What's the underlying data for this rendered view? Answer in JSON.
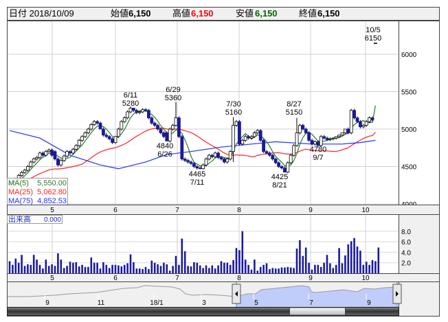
{
  "header": {
    "date_label": "日付 2018/10/09",
    "open_label": "始値",
    "open_value": "6,150",
    "high_label": "高値",
    "high_value": "6,150",
    "low_label": "安値",
    "low_value": "6,150",
    "close_label": "終値",
    "close_value": "6,150"
  },
  "legend": {
    "ma5_label": "MA(5)",
    "ma5_value": "5,550.00",
    "ma25_label": "MA(25)",
    "ma25_value": "5,062.80",
    "ma75_label": "MA(75)",
    "ma75_value": "4,852.53",
    "volume_label": "出来高",
    "volume_value": "0.000"
  },
  "colors": {
    "up_fill": "#ffffff",
    "down_fill": "#1a1a9a",
    "ma5": "#2a7a2a",
    "ma25": "#ff2020",
    "ma75": "#2030ff",
    "volume": "#1a1aa0",
    "nav_selected": "#c0cdfa"
  },
  "annotations": [
    {
      "top": "6/11",
      "bottom": "5280"
    },
    {
      "top": "6/29",
      "bottom": "5360"
    },
    {
      "top": "4840",
      "bottom": "6/26"
    },
    {
      "top": "4465",
      "bottom": "7/11"
    },
    {
      "top": "7/30",
      "bottom": "5160"
    },
    {
      "top": "8/27",
      "bottom": "5150"
    },
    {
      "top": "4425",
      "bottom": "8/21"
    },
    {
      "top": "4780",
      "bottom": "9/7"
    },
    {
      "top": "10/5",
      "bottom": "6150"
    }
  ],
  "nav": {
    "labels": [
      "9",
      "11",
      "18/1",
      "3",
      "5",
      "7",
      "9"
    ]
  },
  "chart_data": {
    "type": "candlestick",
    "price_axis": {
      "ticks": [
        "6000",
        "5500",
        "5000",
        "4500",
        "4000"
      ],
      "range": [
        4000,
        6150
      ]
    },
    "volume_axis": {
      "ticks": [
        "8.0",
        "6.0",
        "4.0",
        "2.0"
      ],
      "range": [
        0,
        9
      ]
    },
    "month_labels": [
      "5",
      "6",
      "7",
      "8",
      "9",
      "10"
    ],
    "open": [
      4260,
      4280,
      4300,
      4330,
      4380,
      4420,
      4450,
      4500,
      4560,
      4600,
      4620,
      4680,
      4650,
      4700,
      4720,
      4700,
      4600,
      4520,
      4580,
      4640,
      4700,
      4680,
      4730,
      4780,
      4850,
      4900,
      4950,
      5000,
      5060,
      5100,
      5080,
      5000,
      4920,
      4900,
      4870,
      4820,
      4900,
      5000,
      5100,
      5150,
      5230,
      5280,
      5250,
      5220,
      5230,
      5260,
      5250,
      5150,
      5080,
      5050,
      5000,
      4950,
      4950,
      4840,
      5000,
      5050,
      5150,
      4900,
      4600,
      4580,
      4560,
      4540,
      4500,
      4480,
      4470,
      4520,
      4600,
      4650,
      4630,
      4680,
      4620,
      4600,
      4560,
      4600,
      4700,
      5050,
      5100,
      4800,
      4850,
      4900,
      4880,
      4900,
      4950,
      4980,
      4850,
      4700,
      4680,
      4650,
      4600,
      4550,
      4500,
      4480,
      4425,
      4550,
      4650,
      4780,
      4950,
      5050,
      5000,
      4950,
      4850,
      4800,
      4830,
      4780,
      4900,
      4880,
      4860,
      4870,
      4880,
      4900,
      4920,
      4950,
      5000,
      4950,
      5250,
      5150,
      5100,
      5030,
      5050,
      5100,
      5150,
      6150
    ],
    "high": [
      4300,
      4320,
      4350,
      4400,
      4440,
      4470,
      4520,
      4580,
      4620,
      4640,
      4700,
      4700,
      4720,
      4740,
      4740,
      4720,
      4620,
      4600,
      4660,
      4720,
      4720,
      4750,
      4800,
      4870,
      4920,
      4970,
      5020,
      5080,
      5120,
      5120,
      5100,
      5020,
      4950,
      4920,
      4890,
      4910,
      5020,
      5120,
      5170,
      5250,
      5300,
      5280,
      5270,
      5250,
      5280,
      5280,
      5270,
      5170,
      5100,
      5070,
      5020,
      4970,
      4970,
      5020,
      5070,
      5360,
      5170,
      4920,
      4620,
      4600,
      4580,
      4560,
      4520,
      4500,
      4540,
      4620,
      4670,
      4670,
      4700,
      4700,
      4640,
      4620,
      4620,
      4720,
      5160,
      5120,
      5120,
      4870,
      4920,
      4920,
      4920,
      4970,
      5000,
      5000,
      4870,
      4720,
      4700,
      4670,
      4620,
      4570,
      4520,
      4500,
      4570,
      4670,
      4800,
      5150,
      5070,
      5070,
      5020,
      4970,
      4870,
      4850,
      4850,
      4920,
      4920,
      4900,
      4890,
      4890,
      4900,
      4920,
      4940,
      4970,
      5020,
      5270,
      5270,
      5170,
      5120,
      5070,
      5120,
      5170,
      5170,
      6150
    ],
    "low": [
      4240,
      4260,
      4280,
      4310,
      4360,
      4400,
      4430,
      4480,
      4540,
      4580,
      4600,
      4630,
      4630,
      4680,
      4630,
      4580,
      4500,
      4500,
      4560,
      4620,
      4660,
      4660,
      4710,
      4760,
      4830,
      4880,
      4930,
      4980,
      5040,
      5060,
      5000,
      4900,
      4880,
      4850,
      4800,
      4800,
      4880,
      4980,
      5080,
      5130,
      5210,
      5230,
      5200,
      5200,
      5210,
      5230,
      5130,
      5060,
      5030,
      4980,
      4930,
      4880,
      4840,
      4820,
      4980,
      5030,
      4880,
      4580,
      4560,
      4540,
      4520,
      4480,
      4460,
      4465,
      4460,
      4500,
      4580,
      4610,
      4610,
      4600,
      4580,
      4540,
      4540,
      4580,
      4560,
      5030,
      4780,
      4780,
      4830,
      4860,
      4860,
      4880,
      4930,
      4830,
      4680,
      4660,
      4630,
      4580,
      4530,
      4480,
      4460,
      4425,
      4410,
      4530,
      4630,
      4760,
      4930,
      4980,
      4930,
      4830,
      4780,
      4780,
      4760,
      4760,
      4860,
      4840,
      4840,
      4850,
      4860,
      4880,
      4900,
      4930,
      4930,
      4930,
      5130,
      5080,
      5010,
      5010,
      5030,
      5080,
      5100,
      6150
    ],
    "close": [
      4280,
      4300,
      4330,
      4380,
      4420,
      4450,
      4500,
      4560,
      4600,
      4620,
      4680,
      4650,
      4700,
      4720,
      4650,
      4600,
      4520,
      4580,
      4640,
      4700,
      4680,
      4730,
      4780,
      4850,
      4900,
      4950,
      5000,
      5060,
      5100,
      5080,
      5000,
      4920,
      4900,
      4870,
      4820,
      4900,
      5000,
      5100,
      5150,
      5230,
      5280,
      5250,
      5220,
      5230,
      5260,
      5250,
      5150,
      5080,
      5050,
      5000,
      4950,
      4900,
      4840,
      5000,
      5050,
      5150,
      4900,
      4600,
      4580,
      4560,
      4540,
      4500,
      4480,
      4470,
      4520,
      4600,
      4650,
      4630,
      4680,
      4620,
      4600,
      4560,
      4600,
      4700,
      5050,
      5100,
      4800,
      4850,
      4900,
      4880,
      4900,
      4950,
      4980,
      4850,
      4700,
      4680,
      4650,
      4600,
      4550,
      4500,
      4480,
      4425,
      4550,
      4650,
      4780,
      4950,
      5050,
      5000,
      4950,
      4850,
      4800,
      4830,
      4780,
      4900,
      4880,
      4860,
      4870,
      4880,
      4900,
      4920,
      4950,
      5000,
      4950,
      5250,
      5150,
      5100,
      5030,
      5050,
      5100,
      5150,
      5120,
      6150
    ],
    "ma75": [
      [
        0,
        4980
      ],
      [
        10,
        4880
      ],
      [
        20,
        4650
      ],
      [
        30,
        4520
      ],
      [
        36,
        4470
      ],
      [
        45,
        4560
      ],
      [
        52,
        4660
      ],
      [
        60,
        4700
      ],
      [
        70,
        4760
      ],
      [
        80,
        4800
      ],
      [
        88,
        4830
      ],
      [
        100,
        4800
      ],
      [
        110,
        4800
      ],
      [
        116,
        4820
      ],
      [
        121,
        4850
      ]
    ],
    "volume": [
      2.3,
      1.6,
      2.8,
      2.0,
      3.5,
      1.4,
      1.7,
      1.6,
      3.5,
      2.6,
      1.6,
      0.9,
      2.6,
      1.4,
      1.7,
      1.4,
      3.8,
      2.6,
      1.0,
      1.4,
      2.2,
      2.0,
      2.1,
      1.3,
      1.6,
      1.2,
      1.2,
      3.0,
      2.0,
      2.0,
      0.9,
      2.1,
      1.6,
      1.0,
      1.6,
      1.6,
      1.5,
      1.3,
      1.6,
      1.9,
      3.6,
      2.1,
      0.9,
      0.9,
      0.8,
      1.2,
      0.8,
      2.4,
      2.0,
      1.7,
      1.4,
      2.0,
      1.7,
      0.5,
      1.4,
      3.3,
      1.6,
      6.6,
      4.2,
      1.4,
      1.3,
      2.1,
      2.0,
      1.5,
      1.0,
      1.5,
      1.0,
      1.5,
      0.9,
      1.5,
      2.3,
      2.0,
      2.0,
      1.6,
      2.5,
      4.8,
      4.4,
      8.0,
      2.6,
      1.6,
      0.7,
      2.6,
      0.5,
      1.2,
      1.6,
      1.9,
      0.8,
      1.0,
      0.9,
      0.9,
      1.1,
      1.1,
      1.2,
      1.1,
      1.0,
      4.7,
      6.3,
      3.3,
      4.9,
      2.0,
      0.7,
      1.6,
      1.6,
      1.2,
      2.0,
      3.5,
      1.9,
      1.0,
      1.6,
      4.8,
      1.9,
      3.4,
      5.5,
      6.1,
      6.7,
      5.1,
      4.3,
      1.6,
      2.2,
      1.6,
      2.5,
      2.3,
      4.9
    ]
  }
}
